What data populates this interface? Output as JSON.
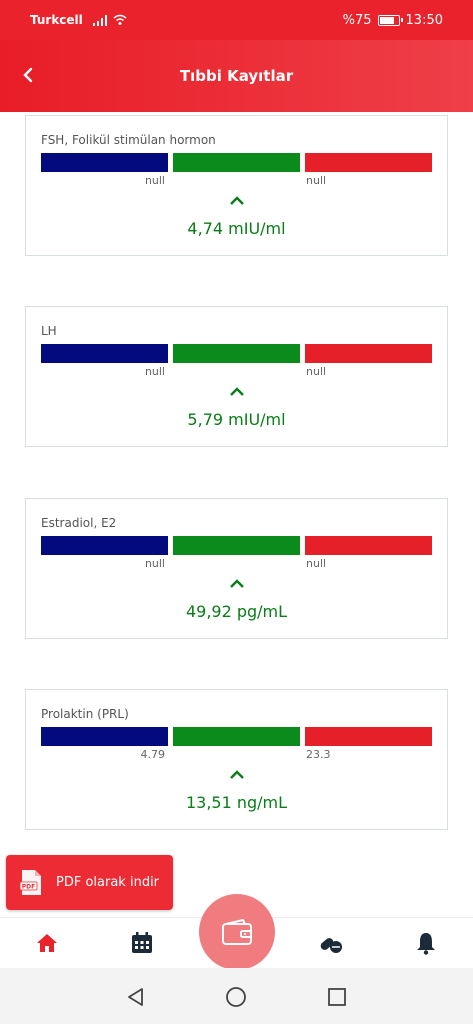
{
  "status_bar": {
    "carrier": "Turkcell",
    "battery": "%75",
    "time": "13:50"
  },
  "app_bar": {
    "title": "Tıbbi Kayıtlar",
    "back_icon": "chevron-left-icon"
  },
  "records": [
    {
      "name": "FSH, Folikül stimülan hormon",
      "low": "null",
      "high": "null",
      "value": "4,74 mIU/ml"
    },
    {
      "name": "LH",
      "low": "null",
      "high": "null",
      "value": "5,79 mIU/ml"
    },
    {
      "name": "Estradiol, E2",
      "low": "null",
      "high": "null",
      "value": "49,92 pg/mL"
    },
    {
      "name": "Prolaktin (PRL)",
      "low": "4.79",
      "high": "23.3",
      "value": "13,51 ng/mL"
    }
  ],
  "pdf_button": {
    "label": "PDF olarak indir",
    "icon": "pdf-file-icon"
  },
  "bottom_nav": [
    "home-icon",
    "calendar-icon",
    "wallet-icon",
    "pills-icon",
    "bell-icon"
  ],
  "colors": {
    "primary": "#e9222b",
    "low_range": "#020a7e",
    "normal_range": "#0a8b1b",
    "high_range": "#e52029",
    "value_text": "#0a7d18"
  }
}
